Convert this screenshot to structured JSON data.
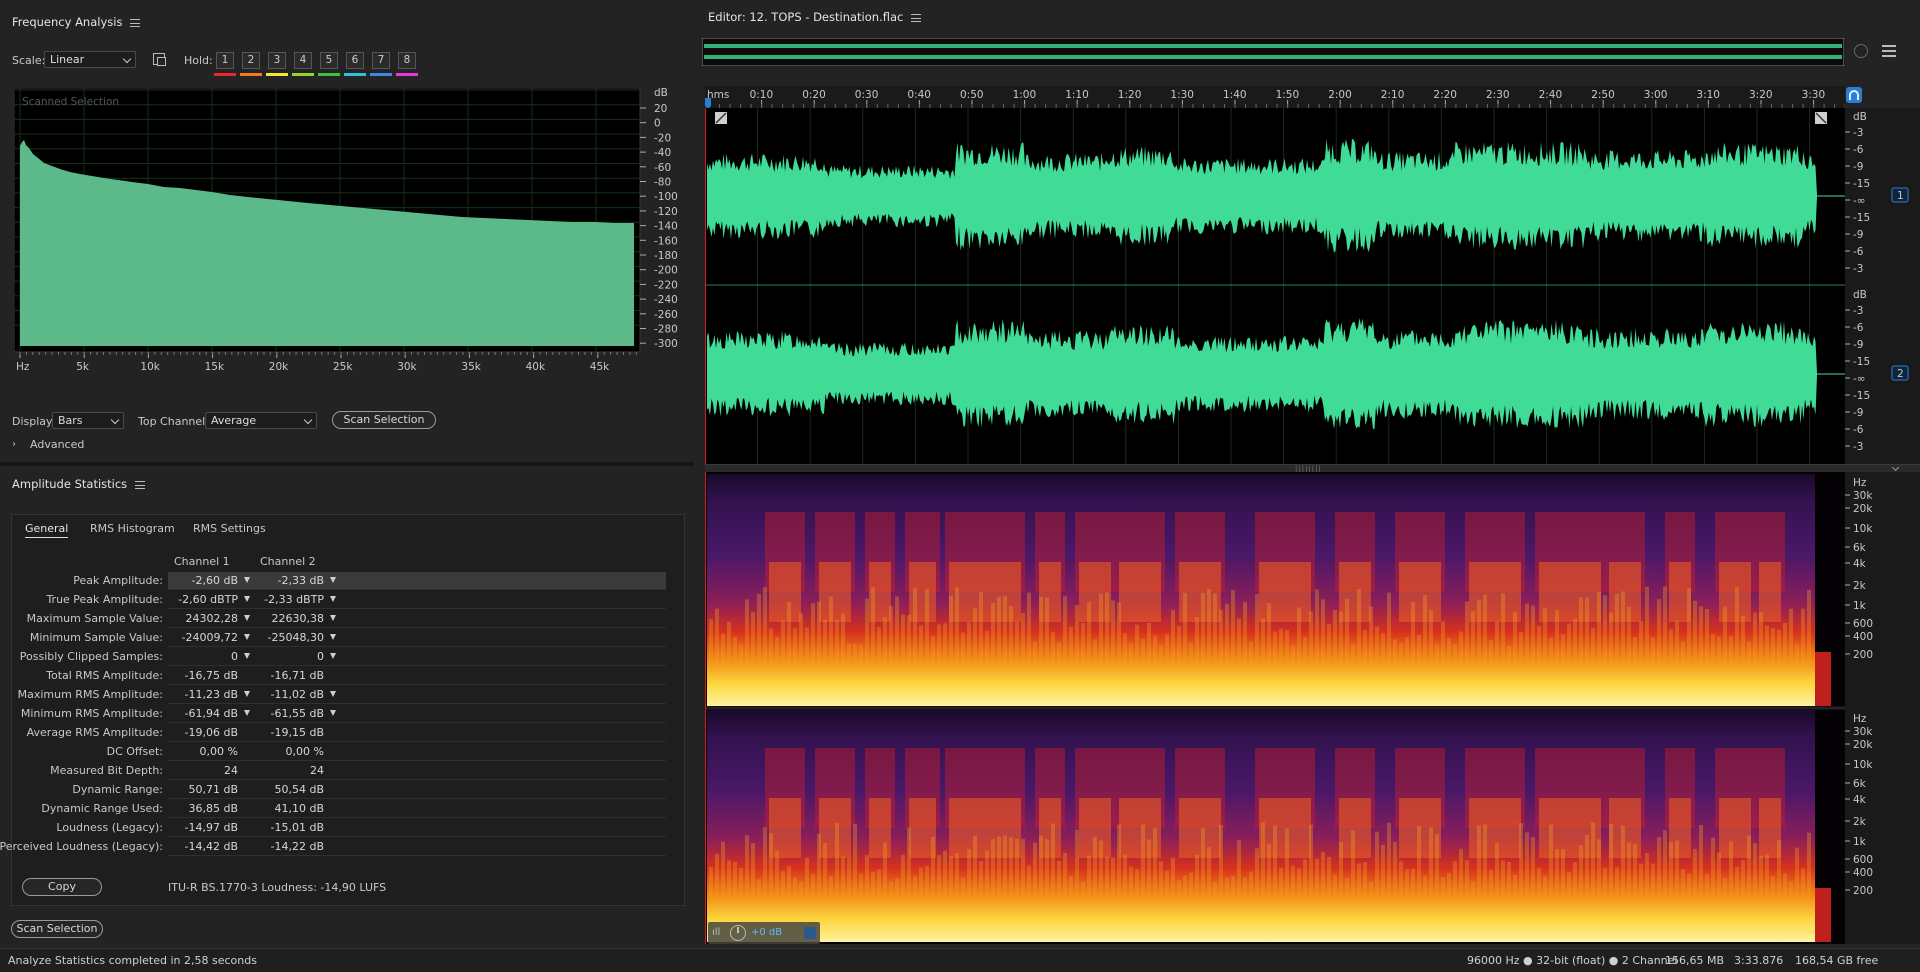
{
  "freq": {
    "title": "Frequency Analysis",
    "scale_label": "Scale:",
    "scale_value": "Linear",
    "hold_label": "Hold:",
    "hold_buttons": [
      "1",
      "2",
      "3",
      "4",
      "5",
      "6",
      "7",
      "8"
    ],
    "hold_colors": [
      "#e8262b",
      "#f07d1e",
      "#f3e82c",
      "#98d22f",
      "#3ec23c",
      "#32c0e0",
      "#3b88e8",
      "#e43ad8"
    ],
    "plot_label": "Scanned Selection",
    "db_unit": "dB",
    "db_ticks": [
      "20",
      "0",
      "-20",
      "-40",
      "-60",
      "-80",
      "-100",
      "-120",
      "-140",
      "-160",
      "-180",
      "-200",
      "-220",
      "-240",
      "-260",
      "-280",
      "-300"
    ],
    "hz_ticks": [
      "Hz",
      "5k",
      "10k",
      "15k",
      "20k",
      "25k",
      "30k",
      "35k",
      "40k",
      "45k"
    ],
    "display_label": "Display:",
    "display_value": "Bars",
    "top_channel_label": "Top Channel:",
    "top_channel_value": "Average",
    "scan_button": "Scan Selection",
    "advanced_label": "Advanced"
  },
  "amp": {
    "title": "Amplitude Statistics",
    "tabs": [
      "General",
      "RMS Histogram",
      "RMS Settings"
    ],
    "col1": "Channel 1",
    "col2": "Channel 2",
    "rows": [
      {
        "label": "Peak Amplitude:",
        "c1": "-2,60 dB",
        "c2": "-2,33 dB",
        "arrow": true
      },
      {
        "label": "True Peak Amplitude:",
        "c1": "-2,60 dBTP",
        "c2": "-2,33 dBTP",
        "arrow": true
      },
      {
        "label": "Maximum Sample Value:",
        "c1": "24302,28",
        "c2": "22630,38",
        "arrow": true
      },
      {
        "label": "Minimum Sample Value:",
        "c1": "-24009,72",
        "c2": "-25048,30",
        "arrow": true
      },
      {
        "label": "Possibly Clipped Samples:",
        "c1": "0",
        "c2": "0",
        "arrow": true
      },
      {
        "label": "Total RMS Amplitude:",
        "c1": "-16,75 dB",
        "c2": "-16,71 dB",
        "arrow": false
      },
      {
        "label": "Maximum RMS Amplitude:",
        "c1": "-11,23 dB",
        "c2": "-11,02 dB",
        "arrow": true
      },
      {
        "label": "Minimum RMS Amplitude:",
        "c1": "-61,94 dB",
        "c2": "-61,55 dB",
        "arrow": true
      },
      {
        "label": "Average RMS Amplitude:",
        "c1": "-19,06 dB",
        "c2": "-19,15 dB",
        "arrow": false
      },
      {
        "label": "DC Offset:",
        "c1": "0,00 %",
        "c2": "0,00 %",
        "arrow": false
      },
      {
        "label": "Measured Bit Depth:",
        "c1": "24",
        "c2": "24",
        "arrow": false
      },
      {
        "label": "Dynamic Range:",
        "c1": "50,71 dB",
        "c2": "50,54 dB",
        "arrow": false
      },
      {
        "label": "Dynamic Range Used:",
        "c1": "36,85 dB",
        "c2": "41,10 dB",
        "arrow": false
      },
      {
        "label": "Loudness (Legacy):",
        "c1": "-14,97 dB",
        "c2": "-15,01 dB",
        "arrow": false
      },
      {
        "label": "Perceived Loudness (Legacy):",
        "c1": "-14,42 dB",
        "c2": "-14,22 dB",
        "arrow": false
      }
    ],
    "copy_button": "Copy",
    "loudness_text": "ITU-R BS.1770-3 Loudness: -14,90 LUFS",
    "scan_button": "Scan Selection"
  },
  "editor": {
    "title": "Editor: 12. TOPS - Destination.flac",
    "time_ticks": [
      "hms",
      "0:10",
      "0:20",
      "0:30",
      "0:40",
      "0:50",
      "1:00",
      "1:10",
      "1:20",
      "1:30",
      "1:40",
      "1:50",
      "2:00",
      "2:10",
      "2:20",
      "2:30",
      "2:40",
      "2:50",
      "3:00",
      "3:10",
      "3:20",
      "3:30"
    ],
    "db_unit": "dB",
    "db_scale": [
      "-3",
      "-6",
      "-9",
      "-15",
      "-∞",
      "-15",
      "-9",
      "-6",
      "-3"
    ],
    "channel_badges": [
      "1",
      "2"
    ],
    "hz_unit": "Hz",
    "hz_scale": [
      "30k",
      "20k",
      "10k",
      "6k",
      "4k",
      "2k",
      "1k",
      "600",
      "400",
      "200"
    ],
    "volume_value": "+0 dB",
    "colors": {
      "wave": "#3fdb97",
      "accent": "#2a7fd4",
      "bg": "#000000"
    }
  },
  "status": {
    "left": "Analyze Statistics completed in 2,58 seconds",
    "sample_info": "96000 Hz ● 32-bit (float) ● 2 Channel",
    "size": "156,65 MB",
    "duration": "3:33.876",
    "free": "168,54 GB free"
  }
}
